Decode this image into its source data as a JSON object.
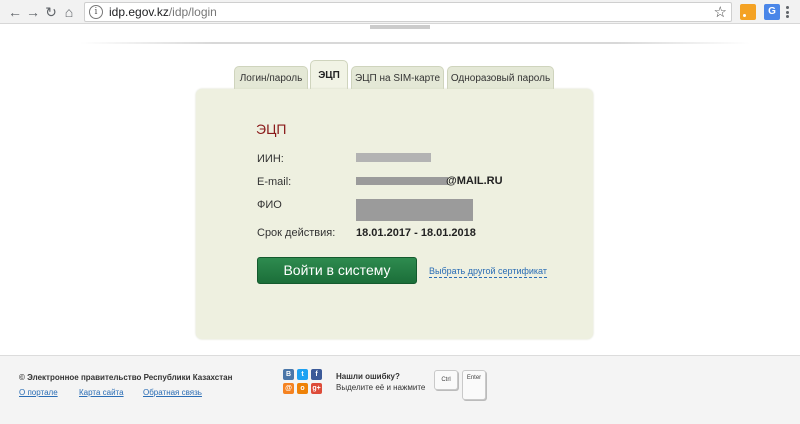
{
  "browser": {
    "url_host": "idp.egov.kz",
    "url_path": "/idp/login",
    "info_glyph": "i",
    "translate_glyph": "G"
  },
  "tabs": [
    {
      "label": "Логин/пароль",
      "active": false
    },
    {
      "label": "ЭЦП",
      "active": true
    },
    {
      "label": "ЭЦП на SIM-карте",
      "active": false
    },
    {
      "label": "Одноразовый пароль",
      "active": false
    }
  ],
  "panel": {
    "title": "ЭЦП",
    "iin_label": "ИИН:",
    "email_label": "E-mail:",
    "email_suffix": "@MAIL.RU",
    "fio_label": "ФИО",
    "validity_label": "Срок действия:",
    "validity_value": "18.01.2017 - 18.01.2018",
    "login_button": "Войти в систему",
    "alt_cert_link": "Выбрать другой сертификат"
  },
  "footer": {
    "copyright": "© Электронное правительство Республики Казахстан",
    "links": [
      "О портале",
      "Карта сайта",
      "Обратная связь"
    ],
    "error_title": "Нашли ошибку?",
    "error_text": "Выделите её и нажмите",
    "key_ctrl": "Ctrl",
    "key_enter": "Enter",
    "social_glyphs": [
      "B",
      "t",
      "f",
      "@",
      "o",
      "g+"
    ]
  },
  "colors": {
    "panel_bg": "#eef0e0",
    "tab_bg": "#e4e8d6",
    "title_red": "#8a1a1a",
    "button_green": "#1f7a3f",
    "link_blue": "#2a6db5"
  }
}
